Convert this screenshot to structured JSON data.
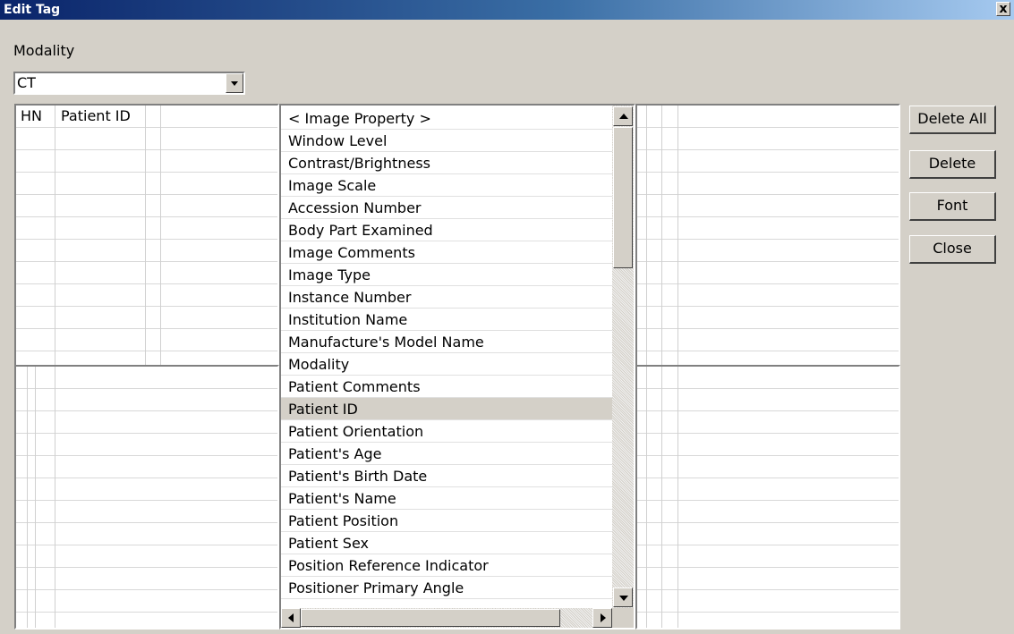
{
  "window": {
    "title": "Edit Tag",
    "close_symbol": "x"
  },
  "modality": {
    "label": "Modality",
    "value": "CT"
  },
  "patient_grid": {
    "headers": [
      "HN",
      "Patient ID"
    ]
  },
  "property_list": {
    "items": [
      "< Image Property >",
      "Window Level",
      "Contrast/Brightness",
      "Image Scale",
      "Accession Number",
      "Body Part Examined",
      "Image Comments",
      "Image Type",
      "Instance Number",
      "Institution Name",
      "Manufacture's Model Name",
      "Modality",
      "Patient Comments",
      "Patient ID",
      "Patient Orientation",
      "Patient's Age",
      "Patient's Birth Date",
      "Patient's Name",
      "Patient Position",
      "Patient Sex",
      "Position Reference Indicator",
      "Positioner Primary Angle"
    ],
    "selected": "Patient ID"
  },
  "buttons": {
    "delete_all": "Delete All",
    "delete": "Delete",
    "font": "Font",
    "close": "Close"
  },
  "colors": {
    "titlebar_start": "#0a246a",
    "titlebar_end": "#a6caf0",
    "face": "#d4d0c8",
    "selected_row": "#d4d0c8"
  }
}
